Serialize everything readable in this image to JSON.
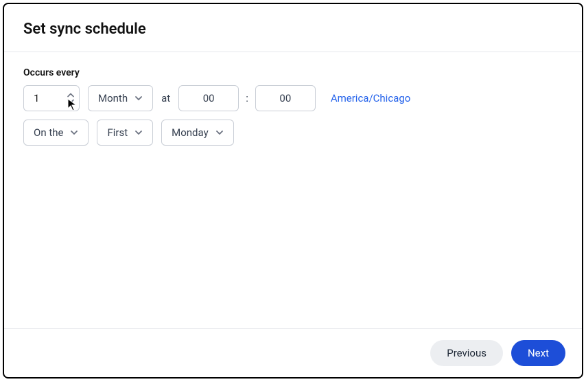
{
  "title": "Set sync schedule",
  "occursLabel": "Occurs every",
  "interval": "1",
  "unit": "Month",
  "atLabel": "at",
  "hour": "00",
  "minute": "00",
  "timezone": "America/Chicago",
  "onThe": "On the",
  "ordinal": "First",
  "weekday": "Monday",
  "buttons": {
    "previous": "Previous",
    "next": "Next"
  }
}
